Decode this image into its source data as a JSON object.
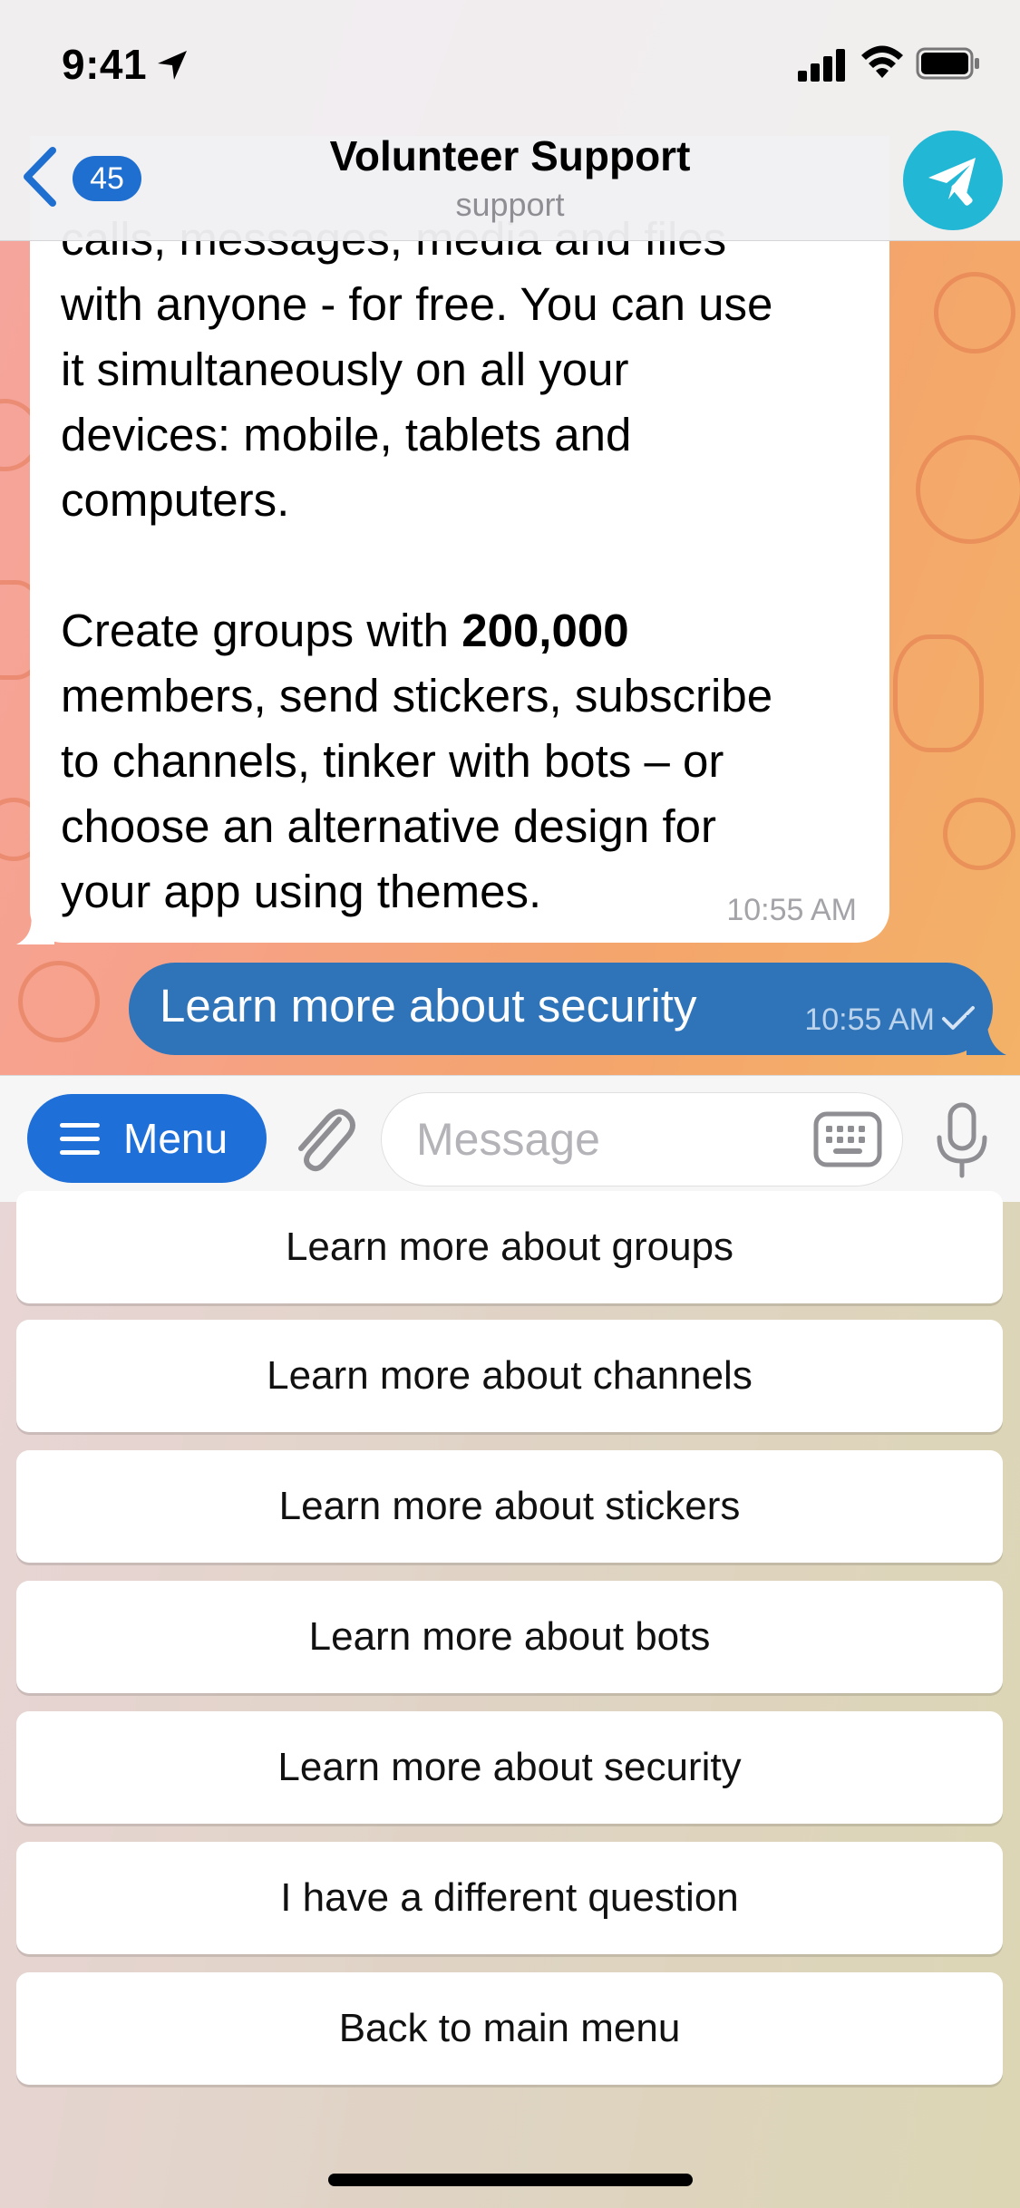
{
  "status": {
    "time": "9:41"
  },
  "header": {
    "back_badge": "45",
    "title": "Volunteer Support",
    "subtitle": "support"
  },
  "messages": {
    "incoming": {
      "part1": "calls, messages, media and files\nwith anyone - for free. You can use\nit simultaneously on all your\ndevices: mobile, tablets and\ncomputers.\n\nCreate groups with ",
      "bold": "200,000",
      "part2": "\nmembers, send stickers, subscribe\nto channels, tinker with bots – or\nchoose an alternative design for\nyour app using themes.",
      "time": "10:55 AM"
    },
    "outgoing": {
      "text": "Learn more about security",
      "time": "10:55 AM"
    }
  },
  "input": {
    "menu_label": "Menu",
    "placeholder": "Message"
  },
  "bot_keyboard": [
    "Learn more about groups",
    "Learn more about channels",
    "Learn more about stickers",
    "Learn more about bots",
    "Learn more about security",
    "I have a different question",
    "Back to main menu"
  ],
  "colors": {
    "accent": "#1f6fd8",
    "outgoing_bubble": "#2f74b9",
    "avatar": "#23b7d6"
  }
}
